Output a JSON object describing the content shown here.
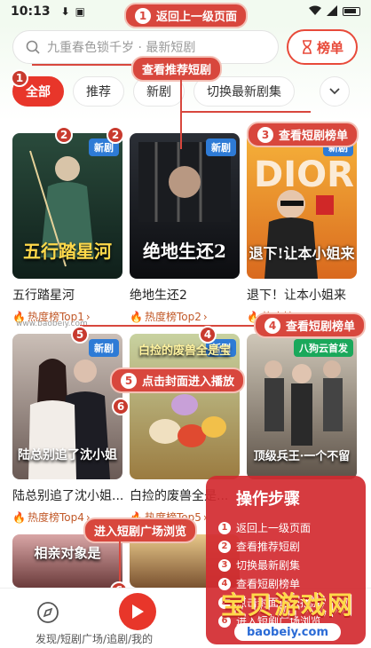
{
  "status_bar": {
    "time": "10:13"
  },
  "search": {
    "placeholder": "九重春色锁千岁 · 最新短剧"
  },
  "rank_button": {
    "label": "榜单"
  },
  "tabs": [
    {
      "label": "全部",
      "active": true
    },
    {
      "label": "推荐"
    },
    {
      "label": "新剧"
    },
    {
      "label": "切换最新剧集"
    }
  ],
  "dramas": [
    {
      "title": "五行踏星河",
      "poster_title": "五行踏星河",
      "badge": "新剧",
      "hot": "热度榜Top1",
      "poster_colors": [
        "#2a4b3c",
        "#0f1f1a"
      ]
    },
    {
      "title": "绝地生还2",
      "poster_title": "绝地生还2",
      "badge": "新剧",
      "hot": "热度榜Top2",
      "poster_colors": [
        "#2b2f36",
        "#0c0d10"
      ]
    },
    {
      "title": "退下！让本小姐来",
      "poster_title": "退下!让本小姐来",
      "badge": "新剧",
      "hot": "热度榜Top3",
      "poster_colors": [
        "#f6b23a",
        "#d9691e"
      ]
    },
    {
      "title": "陆总别追了沈小姐...",
      "poster_title": "陆总别追了沈小姐",
      "badge": "新剧",
      "hot": "热度榜Top4",
      "poster_colors": [
        "#cbbfb7",
        "#6a5a55"
      ]
    },
    {
      "title": "白捡的废兽全是...",
      "poster_title": "白捡的废兽全是宝",
      "badge": "新剧",
      "hot": "热度榜Top5",
      "poster_colors": [
        "#c8d2a0",
        "#9b7b40"
      ]
    },
    {
      "title": "",
      "poster_title": "顶级兵王·一个不留",
      "badge": "八狗云首发",
      "hot": "",
      "poster_colors": [
        "#cfc7b8",
        "#5d5248"
      ]
    }
  ],
  "bottom_row": [
    {
      "poster_title": "相亲对象是",
      "poster_colors": [
        "#d9a6a6",
        "#6b3b3b"
      ]
    },
    {
      "poster_title": "",
      "poster_colors": [
        "#e8c88a",
        "#7a5230"
      ]
    }
  ],
  "watermark_url": "www.baobeiy.com",
  "annotations": {
    "back": {
      "num": "1",
      "text": "返回上一级页面"
    },
    "recommend": {
      "num": "",
      "text": "查看推荐短剧"
    },
    "rank": {
      "num": "3",
      "text": "查看短剧榜单"
    },
    "rank2": {
      "num": "4",
      "text": "查看短剧榜单"
    },
    "cover": {
      "num": "5",
      "text": "点击封面进入播放"
    },
    "square": {
      "text": "进入短剧广场浏览"
    }
  },
  "dots": [
    "1",
    "2",
    "2",
    "5",
    "4",
    "6",
    "6"
  ],
  "bottom_nav": {
    "label": "发现/短剧广场/追剧/我的"
  },
  "steps": {
    "title": "操作步骤",
    "items": [
      {
        "num": "1",
        "text": "返回上一级页面"
      },
      {
        "num": "2",
        "text": "查看推荐短剧"
      },
      {
        "num": "3",
        "text": "切换最新剧集"
      },
      {
        "num": "4",
        "text": "查看短剧榜单"
      },
      {
        "num": "5",
        "text": "点击封面进入播放"
      },
      {
        "num": "6",
        "text": "进入短剧广场浏览"
      }
    ]
  },
  "brand": {
    "name": "宝贝游戏网",
    "url": "baobeiy.com"
  },
  "colors": {
    "accent": "#e8362a",
    "annotation": "#d8473d",
    "badge_blue": "#2e7bd6",
    "badge_green": "#1aa85b"
  }
}
